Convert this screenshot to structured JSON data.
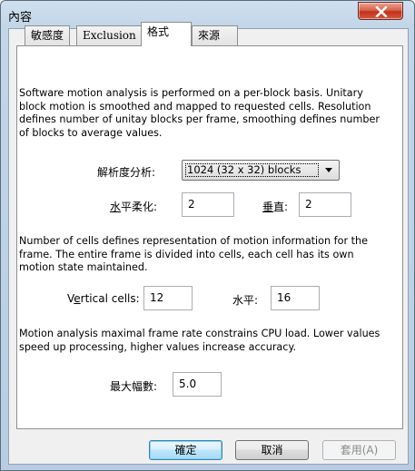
{
  "window": {
    "title": "內容"
  },
  "tabs": [
    {
      "label": "敏感度",
      "active": false
    },
    {
      "label": "Exclusion",
      "active": false
    },
    {
      "label": "格式",
      "active": true
    },
    {
      "label": "來源",
      "active": false
    }
  ],
  "resolution": {
    "description": "Software motion analysis is performed on a per-block basis. Unitary block motion is smoothed and mapped to requested cells. Resolution defines number of unitay blocks per frame, smoothing defines number of blocks to average values.",
    "analysis_label": "解析度分析:",
    "analysis_value": "1024 (32 x 32) blocks",
    "h_smooth_label_u": "水",
    "h_smooth_label_rest": "平柔化:",
    "h_smooth_value": "2",
    "v_label_u": "垂",
    "v_label_rest": "直:",
    "v_value": "2"
  },
  "cells": {
    "description": "Number of cells defines representation of motion information for the frame. The entire frame is divided into cells, each cell has its own motion state maintained.",
    "vertical_label_pre": "V",
    "vertical_label_u": "e",
    "vertical_label_rest": "rtical cells:",
    "vertical_value": "12",
    "horizontal_label": "水平:",
    "horizontal_value": "16"
  },
  "framerate": {
    "description": "Motion analysis maximal frame rate constrains CPU load. Lower values speed up processing, higher values increase accuracy.",
    "max_label": "最大幅數:",
    "max_value": "5.0"
  },
  "buttons": {
    "ok": "確定",
    "cancel": "取消",
    "apply": "套用(A)"
  },
  "colors": {
    "close_button": "#c2301a",
    "default_button_border": "#3c7fb1"
  }
}
